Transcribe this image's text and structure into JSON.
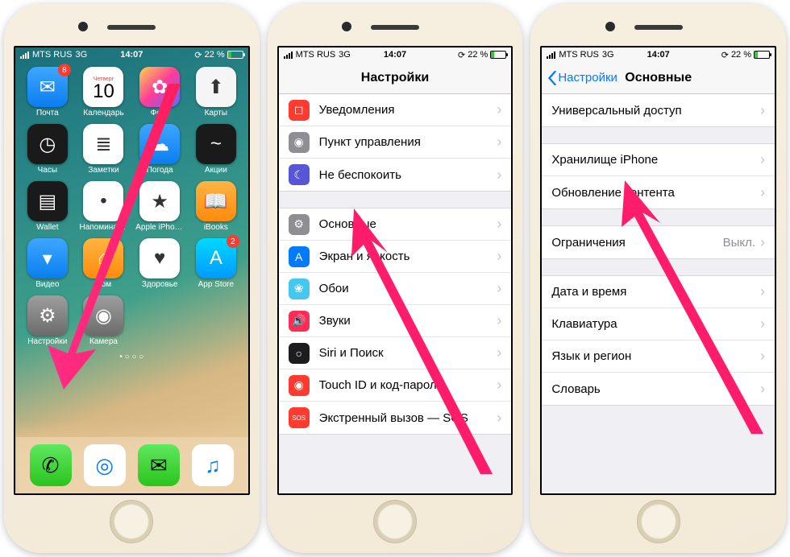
{
  "status": {
    "carrier": "MTS RUS",
    "network": "3G",
    "time": "14:07",
    "battery": "22 %"
  },
  "home": {
    "apps_row1": [
      {
        "name": "Почта",
        "icon": "✉︎",
        "bg": "bg-blue",
        "badge": "8"
      },
      {
        "name": "Календарь",
        "icon": "10",
        "bg": "bg-white",
        "top": "Четверг"
      },
      {
        "name": "Фото",
        "icon": "✿",
        "bg": "bg-grad"
      },
      {
        "name": "Карты",
        "icon": "⬆",
        "bg": "bg-offwhite"
      }
    ],
    "apps_row2": [
      {
        "name": "Часы",
        "icon": "◷",
        "bg": "bg-black"
      },
      {
        "name": "Заметки",
        "icon": "≣",
        "bg": "bg-white"
      },
      {
        "name": "Погода",
        "icon": "☁",
        "bg": "bg-blue"
      },
      {
        "name": "Акции",
        "icon": "~",
        "bg": "bg-black"
      }
    ],
    "apps_row3": [
      {
        "name": "Wallet",
        "icon": "▤",
        "bg": "bg-black"
      },
      {
        "name": "Напоминания",
        "icon": "•",
        "bg": "bg-white"
      },
      {
        "name": "Apple iPhon…",
        "icon": "★",
        "bg": "bg-white"
      },
      {
        "name": "iBooks",
        "icon": "📖",
        "bg": "bg-orange"
      }
    ],
    "apps_row4": [
      {
        "name": "Видео",
        "icon": "▾",
        "bg": "bg-blue"
      },
      {
        "name": "Дом",
        "icon": "⌂",
        "bg": "bg-orange"
      },
      {
        "name": "Здоровье",
        "icon": "♥",
        "bg": "bg-white"
      },
      {
        "name": "App Store",
        "icon": "A",
        "bg": "bg-teal",
        "badge": "2"
      }
    ],
    "apps_row5": [
      {
        "name": "Настройки",
        "icon": "⚙",
        "bg": "bg-grey"
      },
      {
        "name": "Камера",
        "icon": "◉",
        "bg": "bg-grey"
      }
    ],
    "dock": [
      {
        "name": "phone",
        "bg": "bg-green",
        "icon": "✆"
      },
      {
        "name": "safari",
        "bg": "bg-white",
        "icon": "◎"
      },
      {
        "name": "messages",
        "bg": "bg-green",
        "icon": "✉"
      },
      {
        "name": "music",
        "bg": "bg-white",
        "icon": "♫"
      }
    ]
  },
  "settings": {
    "title": "Настройки",
    "rows": [
      {
        "label": "Уведомления",
        "icon": "◻",
        "bg": "#ff3b30"
      },
      {
        "label": "Пункт управления",
        "icon": "◉",
        "bg": "#8e8e93"
      },
      {
        "label": "Не беспокоить",
        "icon": "☾",
        "bg": "#5856d6"
      }
    ],
    "rows2": [
      {
        "label": "Основные",
        "icon": "⚙",
        "bg": "#8e8e93"
      },
      {
        "label": "Экран и яркость",
        "icon": "A",
        "bg": "#007aff"
      },
      {
        "label": "Обои",
        "icon": "❀",
        "bg": "#45c8f0"
      },
      {
        "label": "Звуки",
        "icon": "🔊",
        "bg": "#ff2d55"
      },
      {
        "label": "Siri и Поиск",
        "icon": "○",
        "bg": "#1c1c1e"
      },
      {
        "label": "Touch ID и код-пароль",
        "icon": "◉",
        "bg": "#ff3b30"
      },
      {
        "label": "Экстренный вызов — SOS",
        "icon": "SOS",
        "bg": "#ff3b30"
      }
    ]
  },
  "general": {
    "back": "Настройки",
    "title": "Основные",
    "s1": [
      {
        "label": "Универсальный доступ"
      }
    ],
    "s2": [
      {
        "label": "Хранилище iPhone"
      },
      {
        "label": "Обновление контента"
      }
    ],
    "s3": [
      {
        "label": "Ограничения",
        "detail": "Выкл."
      }
    ],
    "s4": [
      {
        "label": "Дата и время"
      },
      {
        "label": "Клавиатура"
      },
      {
        "label": "Язык и регион"
      },
      {
        "label": "Словарь"
      }
    ]
  }
}
